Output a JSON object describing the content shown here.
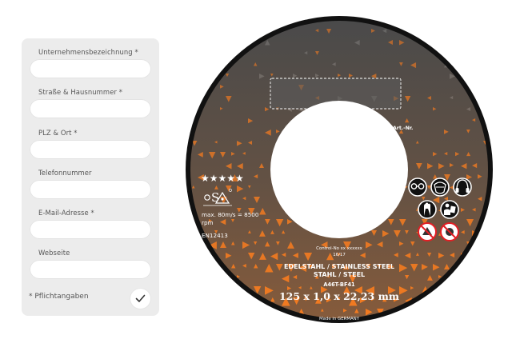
{
  "form": {
    "fields": [
      {
        "label": "Unternehmensbezeichnung *",
        "value": "",
        "placeholder": ""
      },
      {
        "label": "Straße & Hausnummer *",
        "value": "",
        "placeholder": ""
      },
      {
        "label": "PLZ & Ort *",
        "value": "",
        "placeholder": ""
      },
      {
        "label": "Telefonnummer",
        "value": "",
        "placeholder": ""
      },
      {
        "label": "E-Mail-Adresse *",
        "value": "",
        "placeholder": ""
      },
      {
        "label": "Webseite",
        "value": "",
        "placeholder": ""
      }
    ],
    "required_note": "* Pflichtangaben",
    "submit_icon": "checkmark-icon"
  },
  "disc": {
    "stars": "★★★★★",
    "brand": "oSa",
    "speed": "max. 80m/s = 8500 rpm",
    "norm": "EN12413",
    "art_nr": "Art.-Nr.",
    "control_no": "Control-No xx xxxxxx",
    "batch": "16/17",
    "material_line1": "EDELSTAHL / STAINLESS STEEL",
    "material_line2": "STAHL / STEEL",
    "spec": "A46T-BF41",
    "dimensions": "125 x 1,0 x 22,23 mm",
    "made_in": "Made in GERMANY",
    "safety_icons": [
      "goggles-icon",
      "face-mask-icon",
      "ear-protection-icon",
      "gloves-icon",
      "read-manual-icon",
      "no-wet-grinding-icon",
      "no-hand-held-icon"
    ],
    "colors": {
      "rim": "#111111",
      "background": "#4a4a4a",
      "accent": "#f47b20",
      "hole": "#ffffff"
    }
  }
}
